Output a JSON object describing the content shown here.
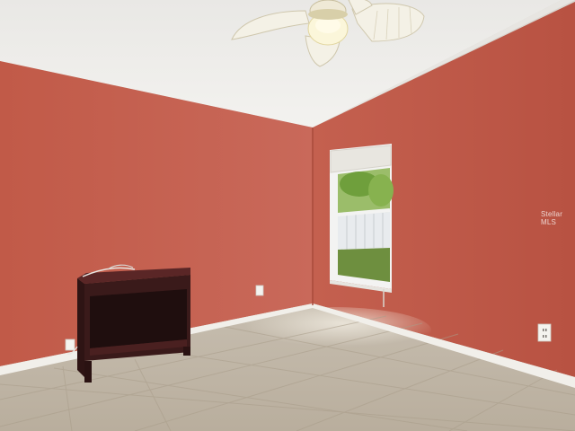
{
  "watermark": {
    "text": "Stellar MLS"
  },
  "colors": {
    "wall_left": "#c35e4c",
    "wall_right": "#bf5848",
    "ceiling": "#ecebe8",
    "floor": "#c9c1b3",
    "baseboard": "#f1efea",
    "table": "#3a1a1a",
    "table_top": "#5a2626",
    "window_frame": "#f3f3f2",
    "grass": "#6e8f3f",
    "foliage": "#7fae4a",
    "fan": "#f4f1e6"
  },
  "icons": [
    "ceiling-fan-icon",
    "electrical-outlet-icon",
    "window-icon"
  ]
}
